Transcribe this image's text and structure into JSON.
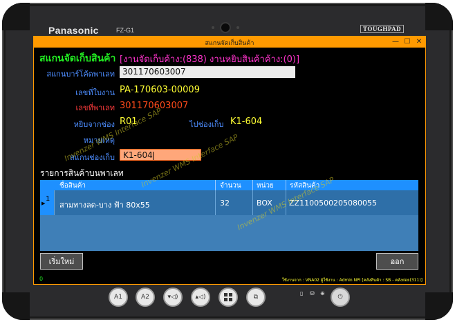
{
  "device": {
    "brand": "Panasonic",
    "model": "FZ-G1",
    "badge": "TOUGHPAD"
  },
  "window": {
    "title": "สแกนจัดเก็บสินค้า",
    "controls": [
      "—",
      "☐",
      "✕"
    ]
  },
  "header": {
    "title": "สแกนจัดเก็บสินค้า",
    "status": "[งานจัดเก็บค้าง:(838)  งานหยิบสินค้าค้าง:(0)]"
  },
  "form": {
    "pallet_barcode_label": "สแกนบาร์โค้ดพาเลท",
    "pallet_barcode_value": "301170603007",
    "doc_no_label": "เลขที่ใบงาน",
    "doc_no_value": "PA-170603-00009",
    "pallet_no_label": "เลขที่พาเลท",
    "pallet_no_value": "301170603007",
    "from_slot_label": "หยิบจากช่อง",
    "from_slot_value": "R01",
    "to_slot_label": "ไปช่องเก็บ",
    "to_slot_value": "K1-604",
    "remark_label": "หมายเหตุ",
    "scan_slot_label": "สแกนช่องเก็บ",
    "scan_slot_value": "K1-604"
  },
  "list": {
    "title": "รายการสินค้าบนพาเลท",
    "columns": [
      "ชื่อสินค้า",
      "จำนวน",
      "หน่วย",
      "รหัสสินค้า"
    ],
    "rows": [
      {
        "index": "1",
        "name": "สามทางลด-บาง ฟ้า 80x55",
        "qty": "32",
        "unit": "BOX",
        "code": "ZZ1100500205080055"
      }
    ]
  },
  "buttons": {
    "new": "เริ่มใหม่",
    "exit": "ออก"
  },
  "footer": {
    "mark": "0",
    "status": "ใช้งานจาก : VNA02 ผู้ใช้งาน : Admin NPI [คลังสินค้า : SB - คลังย่อย(311)]"
  },
  "watermark": "Invenzer WMS Interface SAP",
  "hardware_buttons": [
    "A1",
    "A2",
    "vol-down",
    "vol-up",
    "windows",
    "rotate",
    "power"
  ],
  "colors": {
    "titlebar": "#ff9a00",
    "header_title": "#22ee22",
    "header_status": "#ff33cc",
    "value_yellow": "#ffff33",
    "value_orange": "#ff4a1a",
    "grid_header": "#1e90ff"
  }
}
